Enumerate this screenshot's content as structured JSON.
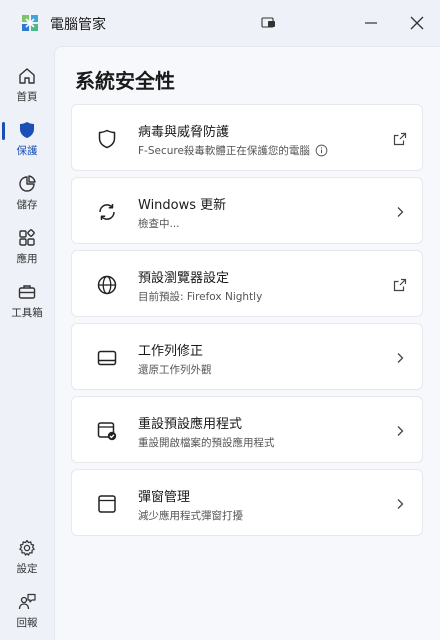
{
  "window": {
    "title": "電腦管家"
  },
  "sidebar": {
    "items": [
      {
        "label": "首頁",
        "icon": "home-icon"
      },
      {
        "label": "保護",
        "icon": "shield-icon",
        "active": true
      },
      {
        "label": "儲存",
        "icon": "pie-chart-icon"
      },
      {
        "label": "應用",
        "icon": "apps-grid-icon"
      },
      {
        "label": "工具箱",
        "icon": "toolbox-icon"
      }
    ],
    "bottom_items": [
      {
        "label": "設定",
        "icon": "gear-icon"
      },
      {
        "label": "回報",
        "icon": "feedback-icon"
      }
    ]
  },
  "main": {
    "title": "系統安全性",
    "cards": [
      {
        "title": "病毒與威脅防護",
        "subtitle": "F-Secure殺毒軟體正在保護您的電腦",
        "icon": "shield-outline-icon",
        "action": "external-link-icon",
        "has_info": true
      },
      {
        "title": "Windows 更新",
        "subtitle": "檢查中...",
        "icon": "refresh-icon",
        "action": "chevron-right-icon"
      },
      {
        "title": "預設瀏覽器設定",
        "subtitle": "目前預設: Firefox Nightly",
        "icon": "globe-icon",
        "action": "external-link-icon"
      },
      {
        "title": "工作列修正",
        "subtitle": "還原工作列外觀",
        "icon": "taskbar-icon",
        "action": "chevron-right-icon"
      },
      {
        "title": "重設預設應用程式",
        "subtitle": "重設開啟檔案的預設應用程式",
        "icon": "default-app-icon",
        "action": "chevron-right-icon"
      },
      {
        "title": "彈窗管理",
        "subtitle": "減少應用程式彈窗打擾",
        "icon": "popup-window-icon",
        "action": "chevron-right-icon"
      }
    ]
  },
  "colors": {
    "accent": "#1a4fb5",
    "background": "#eef1f8",
    "card": "#ffffff"
  }
}
